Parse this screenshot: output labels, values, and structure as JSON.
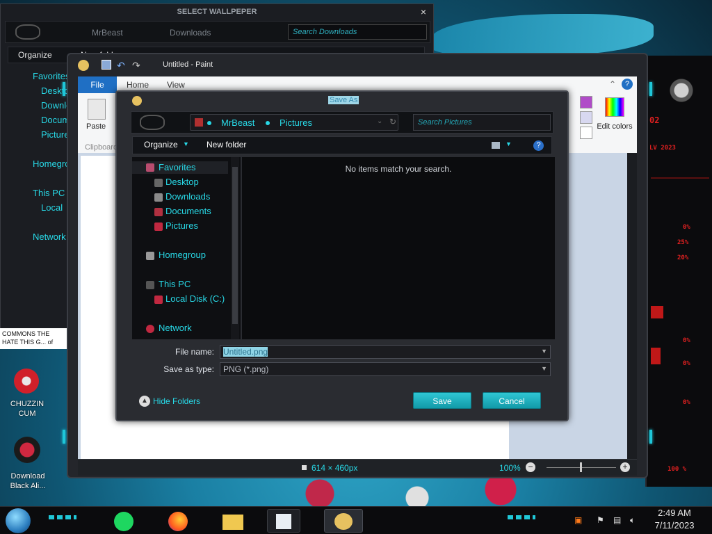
{
  "wallpaper_window": {
    "title": "SELECT WALLPEPER",
    "close": "×",
    "breadcrumb": [
      "MrBeast",
      "Downloads"
    ],
    "search_placeholder": "Search Downloads",
    "toolbar": {
      "organize": "Organize",
      "new_folder": "New folder"
    },
    "sidebar": [
      "Favorites",
      "Desktop",
      "Downloads",
      "Documents",
      "Pictures",
      "Homegroup",
      "This PC",
      "Local",
      "Network"
    ]
  },
  "paint": {
    "title": "Untitled - Paint",
    "tabs": {
      "file": "File",
      "home": "Home",
      "view": "View"
    },
    "ribbon": {
      "paste": "Paste",
      "clipboard": "Clipboard",
      "edit_colors": "Edit colors"
    },
    "status": {
      "dimensions": "614 × 460px",
      "zoom": "100%"
    },
    "palette": [
      "#b04cc8",
      "#d8d8f0",
      "#ffffff",
      "#ffffff",
      "#e8e8f4",
      "#ffffff"
    ]
  },
  "saveas": {
    "title": "Save As",
    "breadcrumb": [
      "MrBeast",
      "Pictures"
    ],
    "search_placeholder": "Search Pictures",
    "toolbar": {
      "organize": "Organize",
      "new_folder": "New folder"
    },
    "tree": {
      "favorites": "Favorites",
      "desktop": "Desktop",
      "downloads": "Downloads",
      "documents": "Documents",
      "pictures": "Pictures",
      "homegroup": "Homegroup",
      "this_pc": "This PC",
      "local_disk": "Local Disk (C:)",
      "network": "Network"
    },
    "empty_message": "No items match your search.",
    "file_name_label": "File name:",
    "file_name_value": "Untitled.png",
    "type_label": "Save as type:",
    "type_value": "PNG (*.png)",
    "hide_folders": "Hide Folders",
    "save": "Save",
    "cancel": "Cancel"
  },
  "desktop": {
    "notification": "COMMONS THE HATE THIS G... of",
    "icons": [
      {
        "label": "CHUZZIN CUM"
      },
      {
        "label": "Download Black Ali..."
      }
    ]
  },
  "gadget": {
    "labels": [
      "02",
      "LV 2023",
      "0%",
      "25%",
      "20%",
      "0%",
      "0%",
      "0%",
      "100 %"
    ]
  },
  "taskbar": {
    "time": "2:49 AM",
    "date": "7/11/2023",
    "apps": [
      "spotify",
      "firefox",
      "file-explorer",
      "notepad",
      "paint"
    ]
  },
  "colors": {
    "accent": "#28d8e6",
    "button": "#1fb4c2",
    "desktop": "#1a7fa3"
  }
}
